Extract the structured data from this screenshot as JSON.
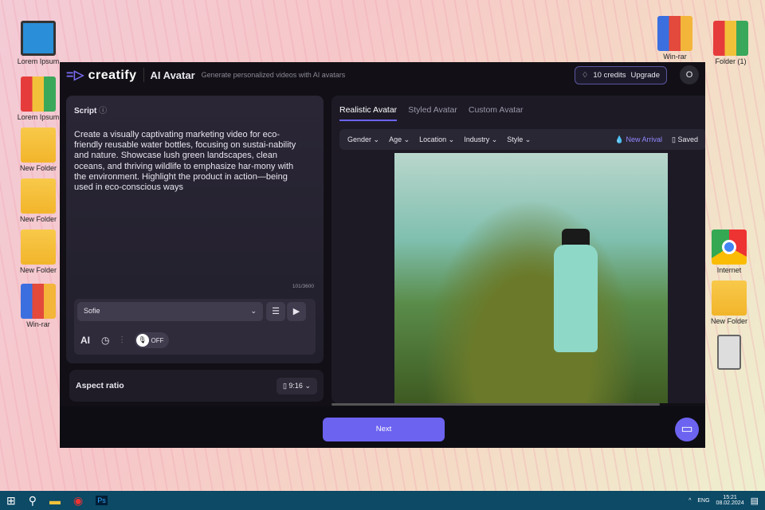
{
  "desktop": {
    "left": [
      "Lorem Ipsum",
      "Lorem Ipsum",
      "New Folder",
      "New Folder",
      "New Folder",
      "Win-rar"
    ],
    "right": [
      "Win-rar",
      "Folder (1)",
      "Internet",
      "New Folder"
    ]
  },
  "app": {
    "logo": "creatify",
    "title": "AI Avatar",
    "subtitle": "Generate personalized videos with AI avatars",
    "credits": "10 credits",
    "upgrade": "Upgrade",
    "avatar": "O"
  },
  "script": {
    "label": "Script",
    "text": "Create a visually captivating marketing video for eco-friendly reusable water bottles, focusing on sustai-nability and nature. Showcase lush green landscapes, clean oceans, and thriving wildlife to emphasize har-mony with the environment. Highlight the product in action—being used in eco-conscious ways",
    "count": "101/3600",
    "voice": "Sofie",
    "ai": "AI",
    "toggle": "OFF"
  },
  "aspect": {
    "label": "Aspect ratio",
    "value": "9:16"
  },
  "tabs": [
    "Realistic Avatar",
    "Styled Avatar",
    "Custom Avatar"
  ],
  "filters": [
    "Gender",
    "Age",
    "Location",
    "Industry",
    "Style"
  ],
  "new_arrival": "New Arrival",
  "saved": "Saved",
  "next": "Next",
  "taskbar": {
    "lang": "ENG",
    "time": "15:21",
    "date": "08.02.2024"
  }
}
